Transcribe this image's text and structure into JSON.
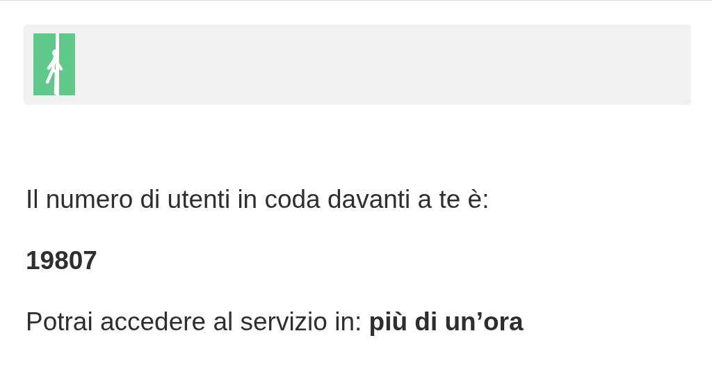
{
  "queue_text": "Il numero di utenti in coda davanti a te è:",
  "queue_count": "19807",
  "wait_text": "Potrai accedere al servizio in: **più di un’ora**"
}
